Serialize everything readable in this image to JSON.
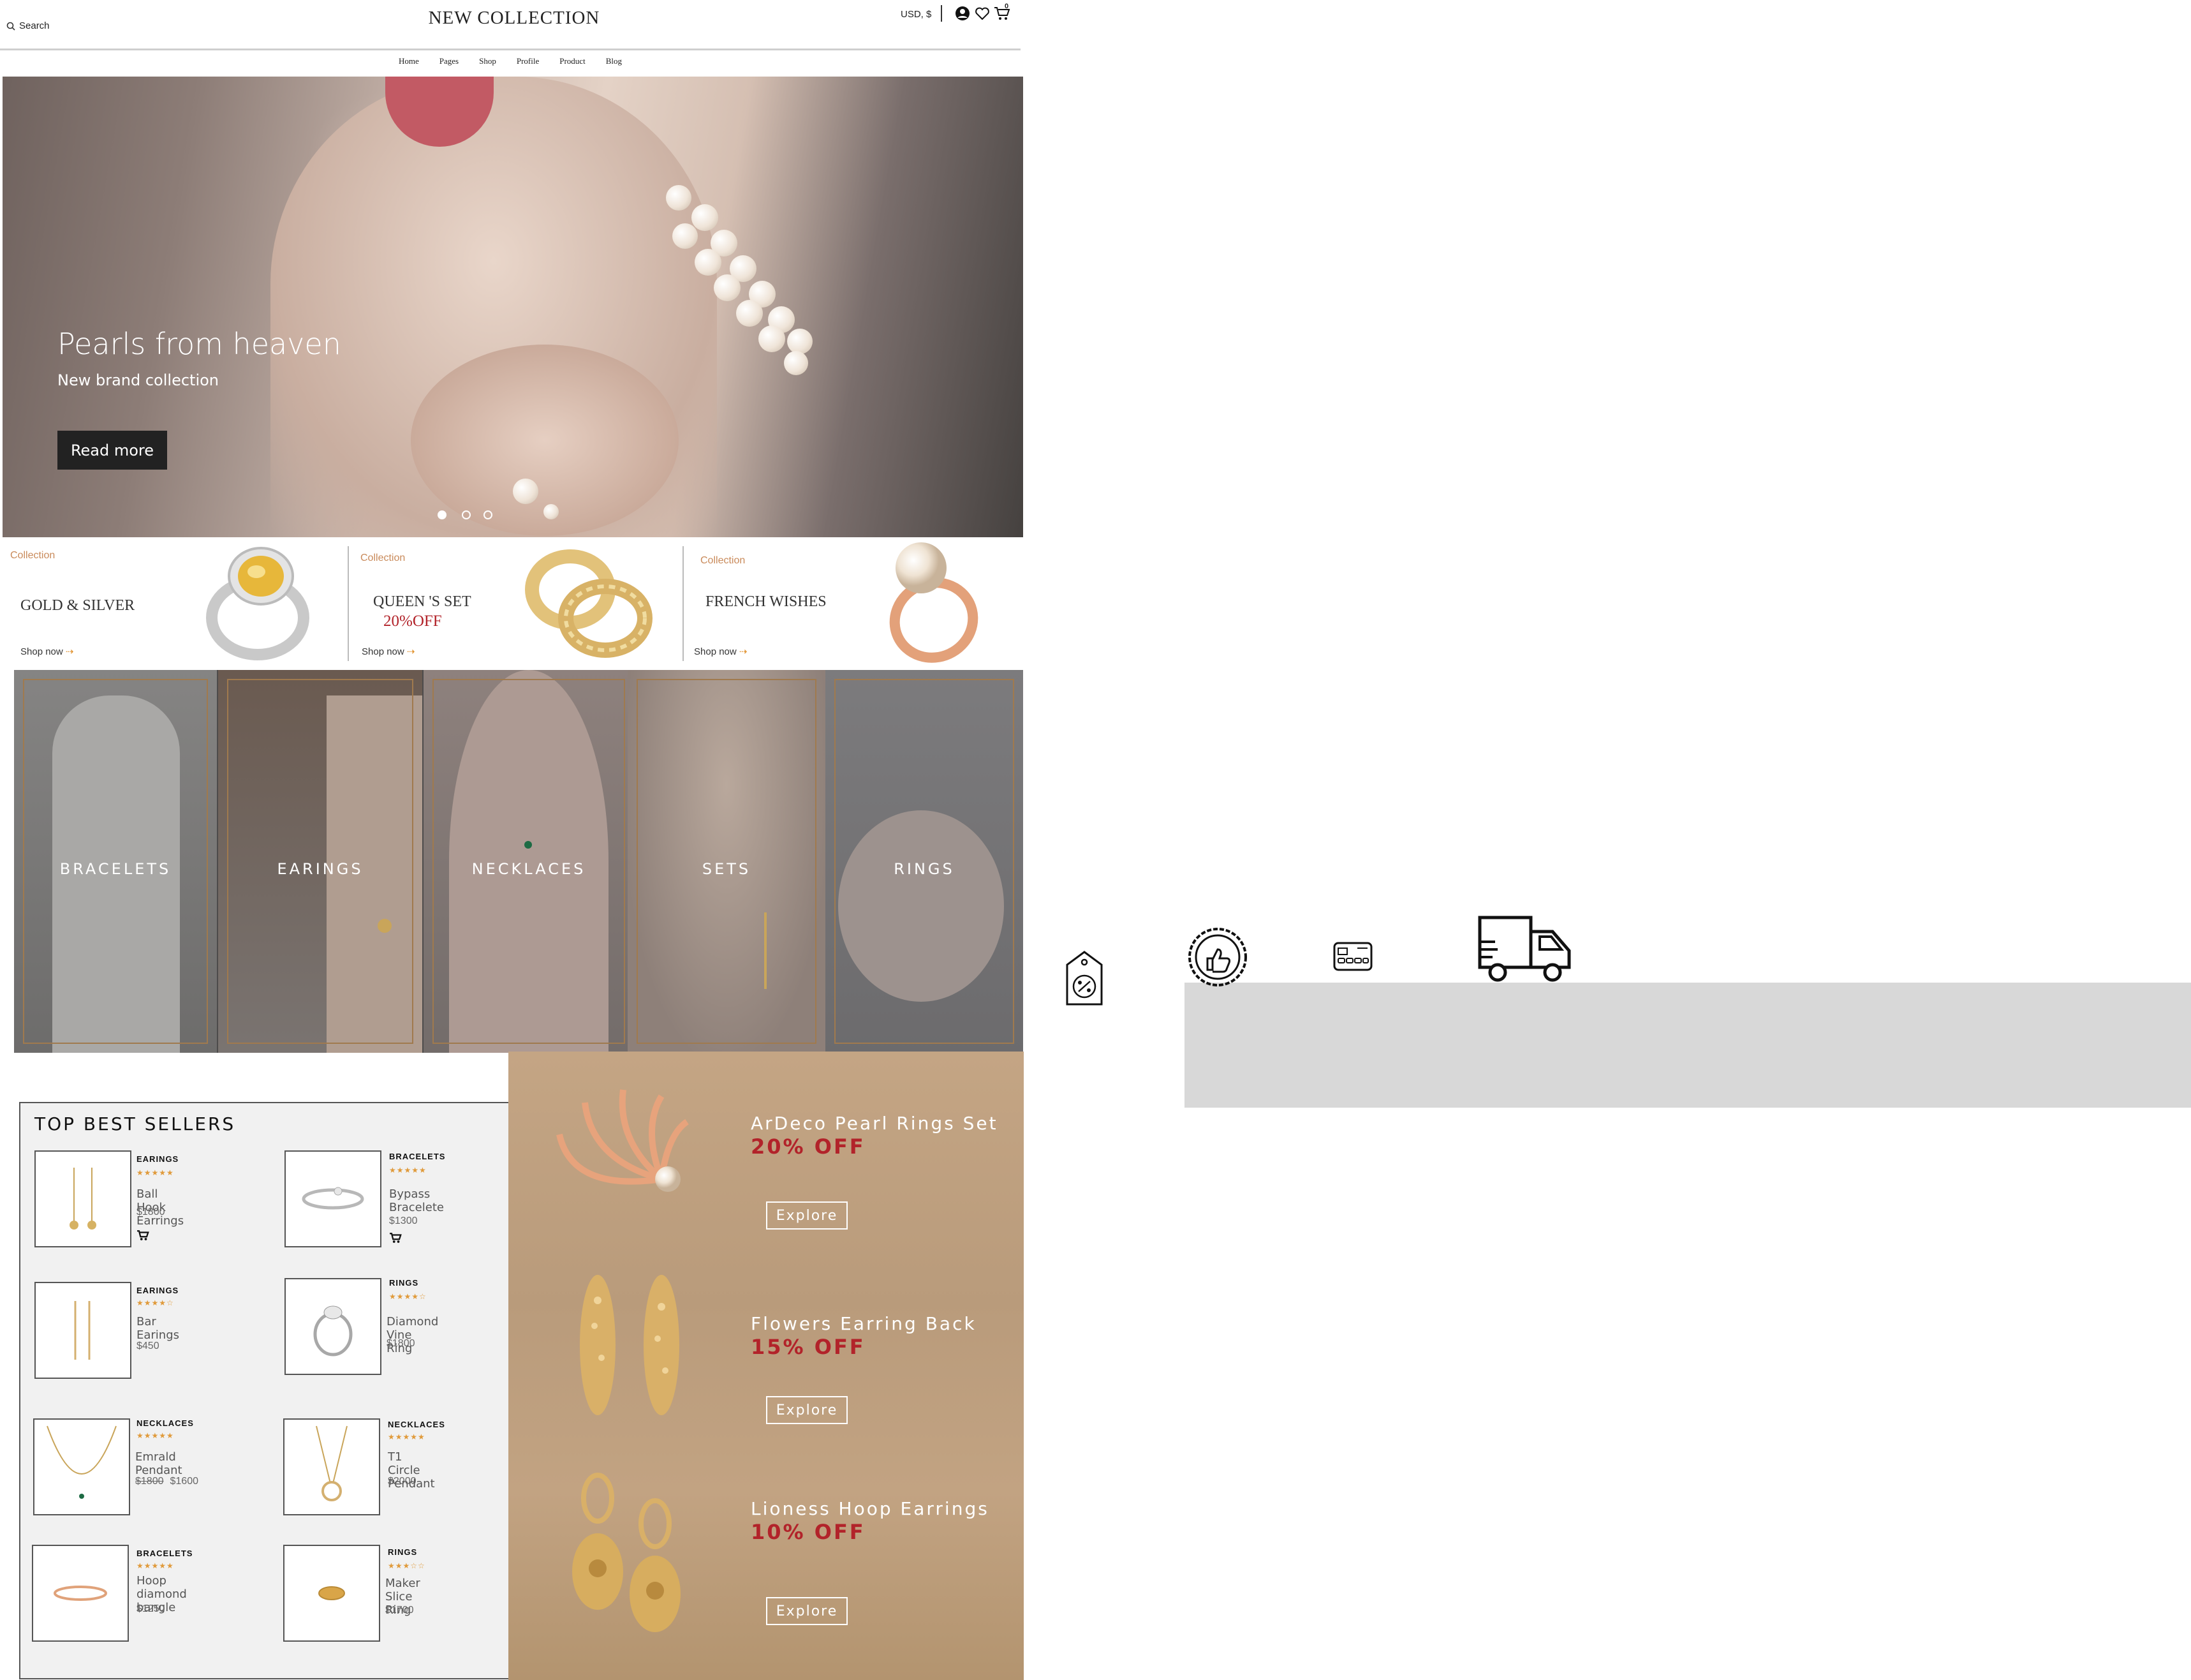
{
  "header": {
    "search_label": "Search",
    "brand": "NEW COLLECTION",
    "currency": "USD, $",
    "cart_count": "0"
  },
  "nav": [
    "Home",
    "Pages",
    "Shop",
    "Profile",
    "Product",
    "Blog"
  ],
  "hero": {
    "title": "Pearls from heaven",
    "subtitle": "New brand collection",
    "button": "Read more",
    "slide_count": 3,
    "active_slide": 1
  },
  "collections": [
    {
      "label": "Collection",
      "name": "GOLD & SILVER",
      "discount": "",
      "shop": "Shop now",
      "arrow": "⇢"
    },
    {
      "label": "Collection",
      "name": "QUEEN 'S SET",
      "discount": "20%OFF",
      "shop": "Shop now",
      "arrow": "⇢"
    },
    {
      "label": "Collection",
      "name": "FRENCH WISHES",
      "discount": "",
      "shop": "Shop now",
      "arrow": "⇢"
    }
  ],
  "categories": [
    "BRACELETS",
    "EARINGS",
    "NECKLACES",
    "SETS",
    "RINGS"
  ],
  "best_sellers": {
    "title": "TOP BEST SELLERS",
    "products": [
      {
        "category": "EARINGS",
        "stars": "★★★★★",
        "name": "Ball Hook Earrings",
        "old_price": "",
        "price": "$1800",
        "cart": true
      },
      {
        "category": "BRACELETS",
        "stars": "★★★★★",
        "name": "Bypass Bracelete",
        "old_price": "",
        "price": "$1300",
        "cart": true
      },
      {
        "category": "EARINGS",
        "stars": "★★★★☆",
        "name": "Bar Earings",
        "old_price": "",
        "price": "$450",
        "cart": false
      },
      {
        "category": "RINGS",
        "stars": "★★★★☆",
        "name": "Diamond  Vine Ring",
        "old_price": "",
        "price": "$1800",
        "cart": false
      },
      {
        "category": "NECKLACES",
        "stars": "★★★★★",
        "name": "Emrald Pendant",
        "old_price": "$1800",
        "price": "$1600",
        "cart": false
      },
      {
        "category": "NECKLACES",
        "stars": "★★★★★",
        "name": "T1 Circle Pendant",
        "old_price": "",
        "price": "$2000",
        "cart": false
      },
      {
        "category": "BRACELETS",
        "stars": "★★★★★",
        "name": "Hoop diamond bangle",
        "old_price": "",
        "price": "$1250",
        "cart": false
      },
      {
        "category": "RINGS",
        "stars": "★★★☆☆",
        "name": "Maker Slice Ring",
        "old_price": "",
        "price": "$1700",
        "cart": false
      }
    ]
  },
  "promos": [
    {
      "title": "ArDeco Pearl Rings Set",
      "discount": "20% OFF",
      "button": "Explore"
    },
    {
      "title": "Flowers Earring Back",
      "discount": "15% OFF",
      "button": "Explore"
    },
    {
      "title": "Lioness Hoop Earrings",
      "discount": "10% OFF",
      "button": "Explore"
    }
  ],
  "feature_icons": [
    "discount-tag-icon",
    "thumbs-up-badge-icon",
    "credit-card-icon",
    "delivery-truck-icon"
  ],
  "colors": {
    "accent_orange": "#c98a5a",
    "discount_red": "#b2232a",
    "promo_bg": "#bfa07e",
    "dark_button": "#222222",
    "category_frame": "#a07a4e"
  }
}
